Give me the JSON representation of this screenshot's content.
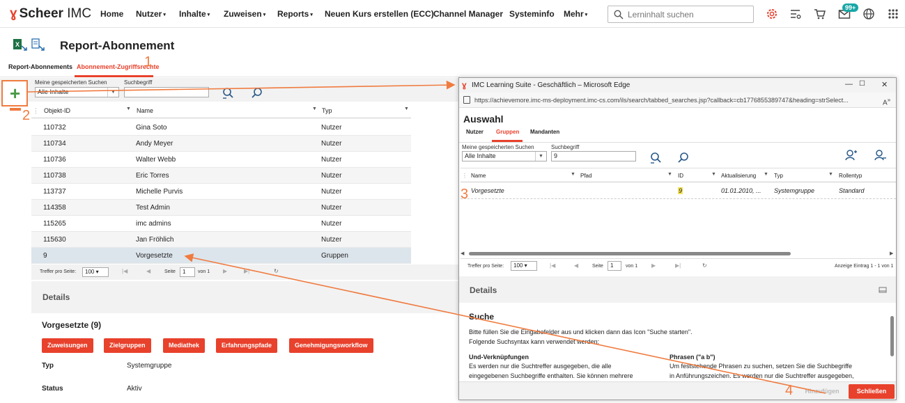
{
  "brand": {
    "mark": "ɣ",
    "name": "Scheer",
    "suffix": " IMC"
  },
  "nav": {
    "items": [
      {
        "label": "Home",
        "caret": ""
      },
      {
        "label": "Nutzer",
        "caret": "▾"
      },
      {
        "label": "Inhalte",
        "caret": "▾"
      },
      {
        "label": "Zuweisen",
        "caret": "▾"
      },
      {
        "label": "Reports",
        "caret": "▾"
      },
      {
        "label": "Neuen Kurs erstellen (ECC)",
        "caret": ""
      },
      {
        "label": "Channel Manager",
        "caret": ""
      },
      {
        "label": "Systeminfo",
        "caret": ""
      },
      {
        "label": "Mehr",
        "caret": "▾"
      }
    ],
    "search_placeholder": "Lerninhalt suchen",
    "badge": "99+",
    "accent": "#e8412c"
  },
  "page": {
    "title": "Report-Abonnement",
    "tabs": [
      "Report-Abonnements",
      "Abonnement-Zugriffsrechte"
    ],
    "saved_search_label": "Meine gespeicherten Suchen",
    "saved_search_value": "Alle Inhalte",
    "search_term_label": "Suchbegriff",
    "search_term_value": ""
  },
  "table": {
    "headers": [
      "Objekt-ID",
      "Name",
      "Typ"
    ],
    "rows": [
      [
        "110732",
        "Gina Soto",
        "Nutzer"
      ],
      [
        "110734",
        "Andy Meyer",
        "Nutzer"
      ],
      [
        "110736",
        "Walter Webb",
        "Nutzer"
      ],
      [
        "110738",
        "Eric Torres",
        "Nutzer"
      ],
      [
        "113737",
        "Michelle Purvis",
        "Nutzer"
      ],
      [
        "114358",
        "Test Admin",
        "Nutzer"
      ],
      [
        "115265",
        "imc admins",
        "Nutzer"
      ],
      [
        "115630",
        "Jan Fröhlich",
        "Nutzer"
      ],
      [
        "9",
        "Vorgesetzte",
        "Gruppen"
      ]
    ],
    "pager": {
      "per_page_label": "Treffer pro Seite:",
      "per_page": "100",
      "page_label": "Seite",
      "page": "1",
      "of_label": "von 1"
    }
  },
  "details": {
    "title": "Details",
    "object_title": "Vorgesetzte (9)",
    "buttons": [
      "Zuweisungen",
      "Zielgruppen",
      "Mediathek",
      "Erfahrungspfade",
      "Genehmigungsworkflow"
    ],
    "fields": [
      {
        "key": "Typ",
        "value": "Systemgruppe"
      },
      {
        "key": "Status",
        "value": "Aktiv"
      }
    ]
  },
  "popup": {
    "window_title": "IMC Learning Suite - Geschäftlich – Microsoft Edge",
    "url": "https://achievemore.imc-ms-deployment.imc-cs.com/ils/search/tabbed_searches.jsp?callback=cb1776855389747&heading=strSelect...",
    "heading": "Auswahl",
    "tabs": [
      "Nutzer",
      "Gruppen",
      "Mandanten"
    ],
    "saved_search_label": "Meine gespeicherten Suchen",
    "saved_search_value": "Alle Inhalte",
    "search_term_label": "Suchbegriff",
    "search_term_value": "9",
    "headers": [
      "Name",
      "Pfad",
      "ID",
      "Aktualisierung",
      "Typ",
      "Rollentyp"
    ],
    "row": {
      "name": "Vorgesetzte",
      "path": "",
      "id": "9",
      "updated": "01.01.2010, ...",
      "type": "Systemgruppe",
      "role": "Standard"
    },
    "pager": {
      "per_page_label": "Treffer pro Seite:",
      "per_page": "100",
      "page_label": "Seite",
      "page": "1",
      "of_label": "von 1",
      "summary": "Anzeige Eintrag 1 - 1 von 1"
    },
    "details_title": "Details",
    "help": {
      "title": "Suche",
      "intro1": "Bitte füllen Sie die Eingabefelder aus und klicken dann das Icon \"Suche starten\".",
      "intro2": "Folgende Suchsyntax kann verwendet werden:",
      "left_title": "Und-Verknüpfungen",
      "left_l1": "Es werden nur die Suchtreffer ausgegeben, die alle",
      "left_l2": "eingegebenen Suchbegriffe enthalten. Sie können mehrere",
      "right_title": "Phrasen (\"a b\")",
      "right_l1": "Um feststehende Phrasen zu suchen, setzen Sie die Suchbegriffe",
      "right_l2": "in Anführungszeichen. Es werden nur die Suchtreffer ausgegeben,"
    },
    "add_button": "Hinzufügen",
    "close_button": "Schließen"
  },
  "annotations": [
    "1",
    "2",
    "3",
    "4"
  ],
  "colors": {
    "accent": "#e8412c",
    "annotation": "#f07b3f",
    "add_icon": "#4a9a48",
    "badge": "#19a6a6"
  }
}
